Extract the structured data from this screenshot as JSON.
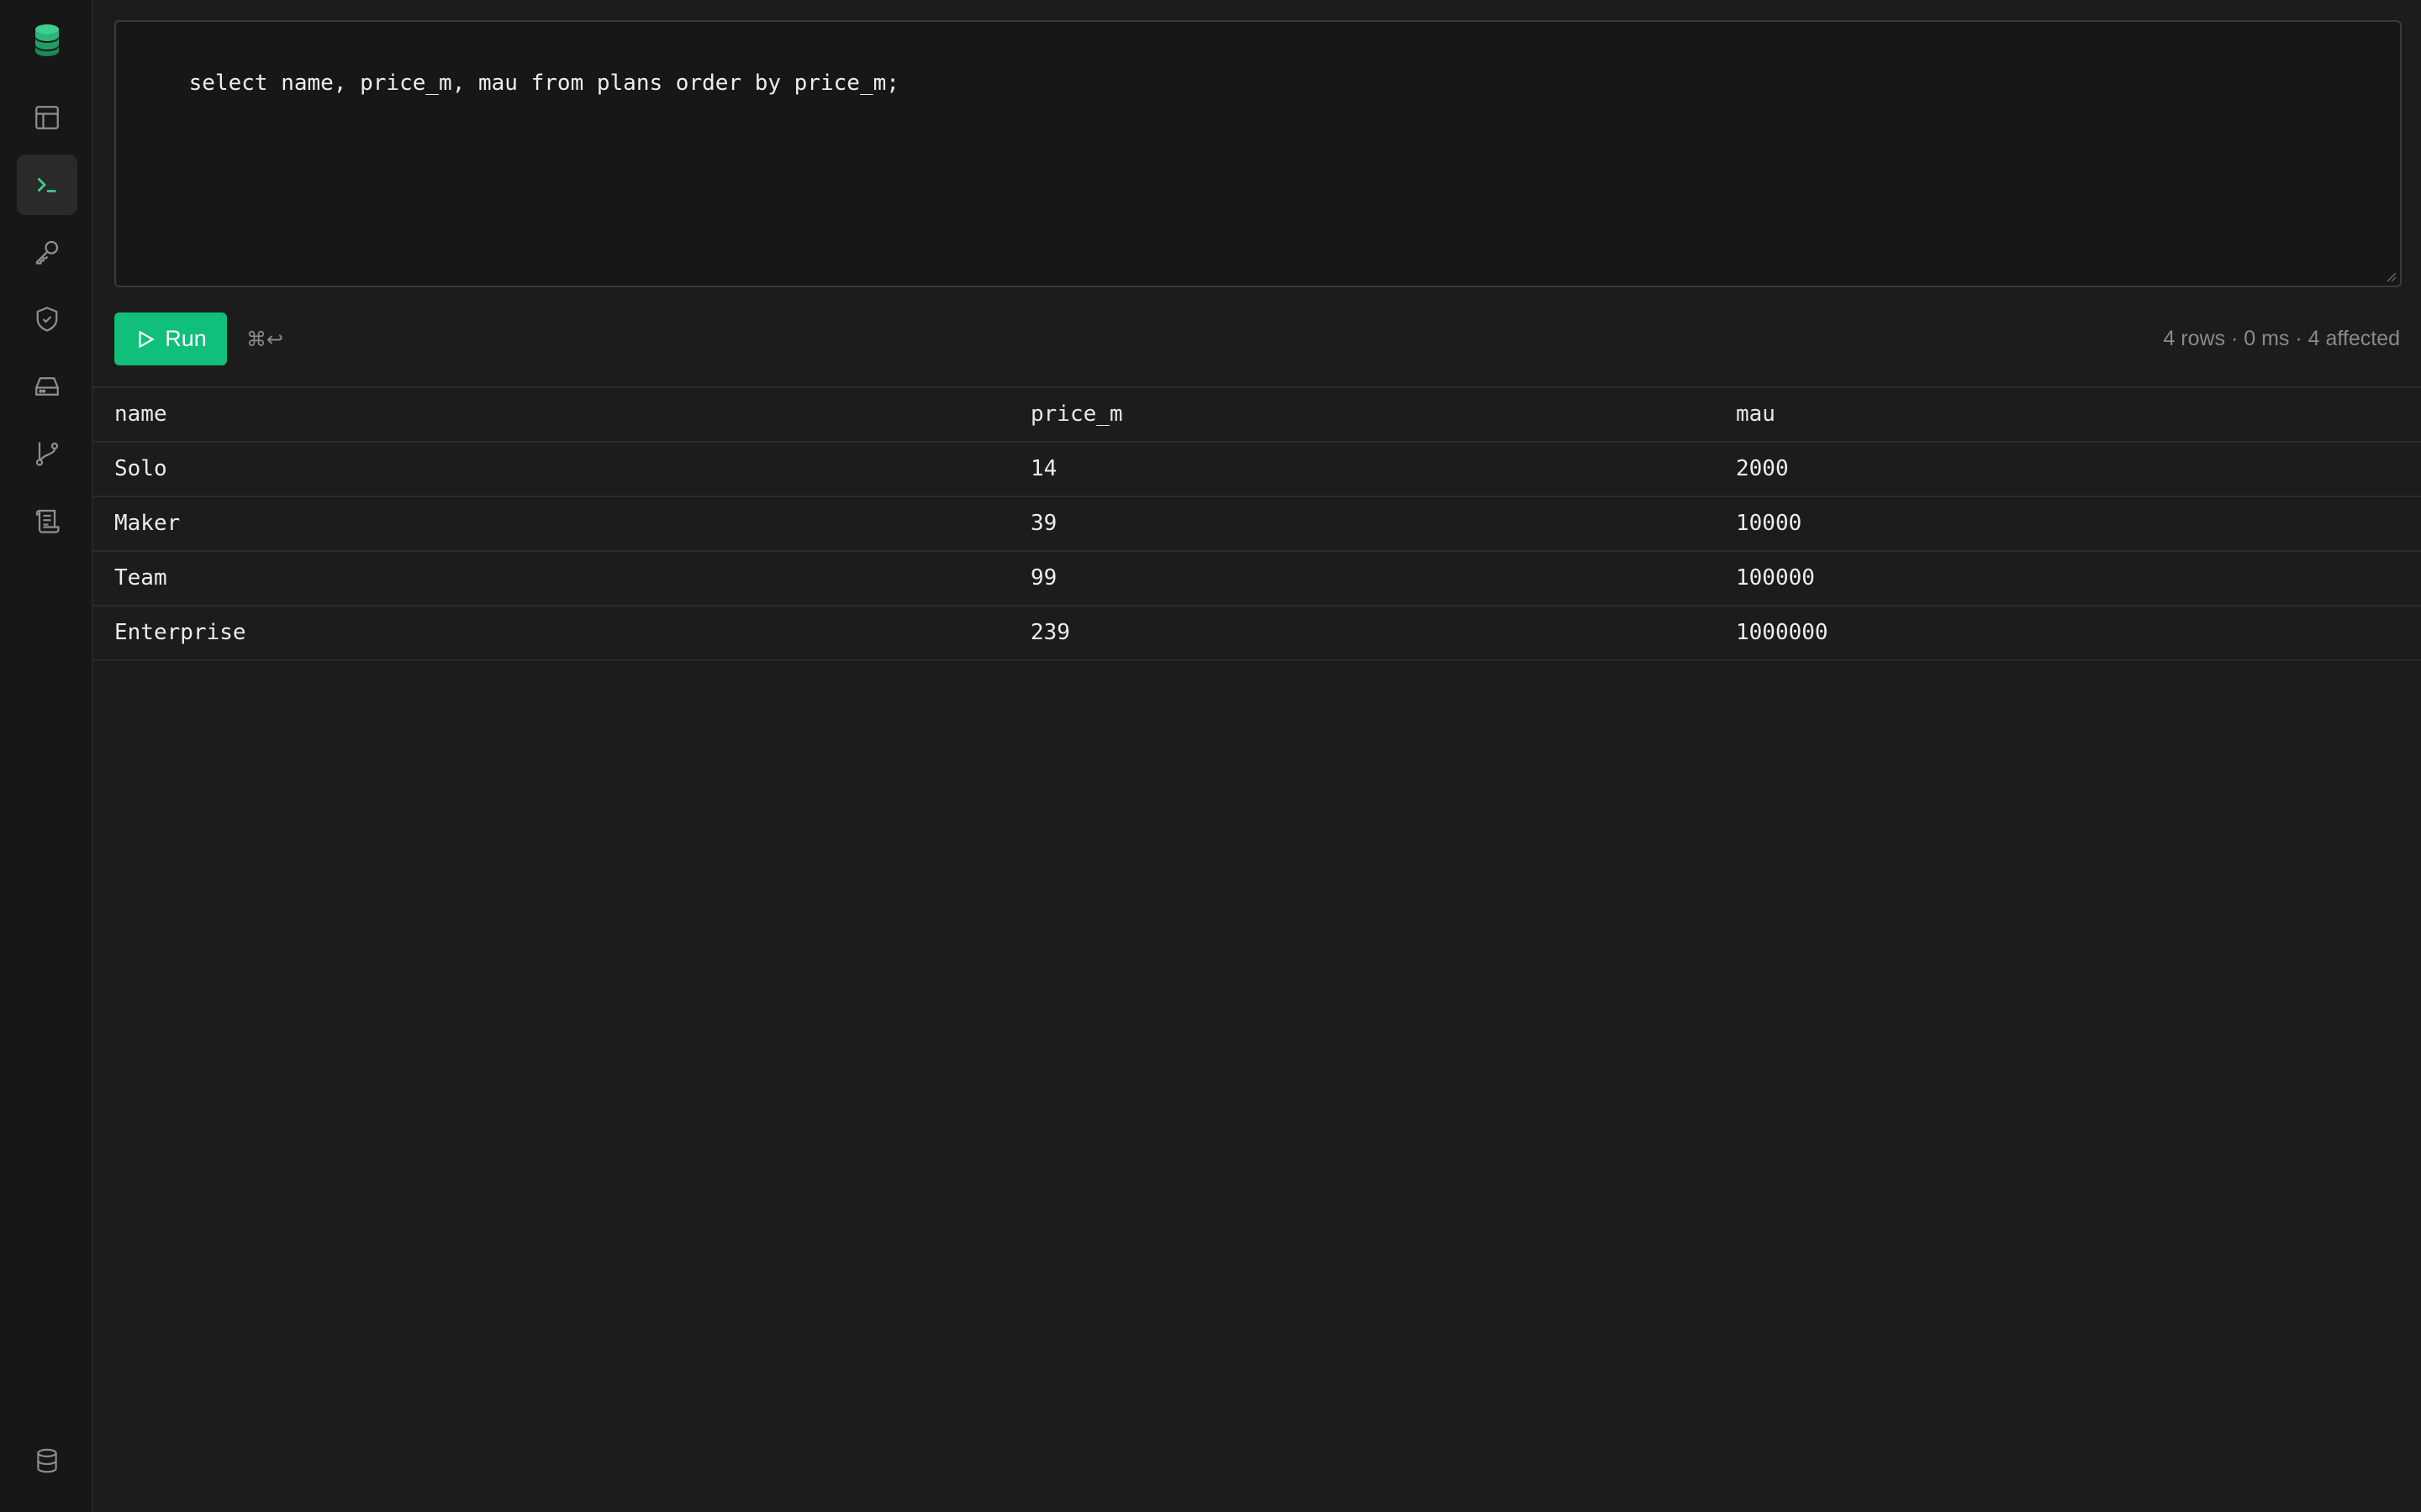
{
  "sidebar": {
    "items": [
      {
        "icon": "table-icon"
      },
      {
        "icon": "terminal-icon"
      },
      {
        "icon": "key-icon"
      },
      {
        "icon": "shield-check-icon"
      },
      {
        "icon": "storage-icon"
      },
      {
        "icon": "git-branch-icon"
      },
      {
        "icon": "scroll-log-icon"
      }
    ],
    "bottom_icon": "database-icon"
  },
  "editor": {
    "query": "select name, price_m, mau from plans order by price_m;"
  },
  "toolbar": {
    "run_label": "Run",
    "shortcut": "⌘↩",
    "status": "4 rows · 0 ms · 4 affected"
  },
  "results": {
    "columns": [
      "name",
      "price_m",
      "mau"
    ],
    "rows": [
      [
        "Solo",
        "14",
        "2000"
      ],
      [
        "Maker",
        "39",
        "10000"
      ],
      [
        "Team",
        "99",
        "100000"
      ],
      [
        "Enterprise",
        "239",
        "1000000"
      ]
    ]
  },
  "colors": {
    "accent": "#0fbf7a",
    "background": "#1c1c1c",
    "sidebar": "#171717"
  }
}
